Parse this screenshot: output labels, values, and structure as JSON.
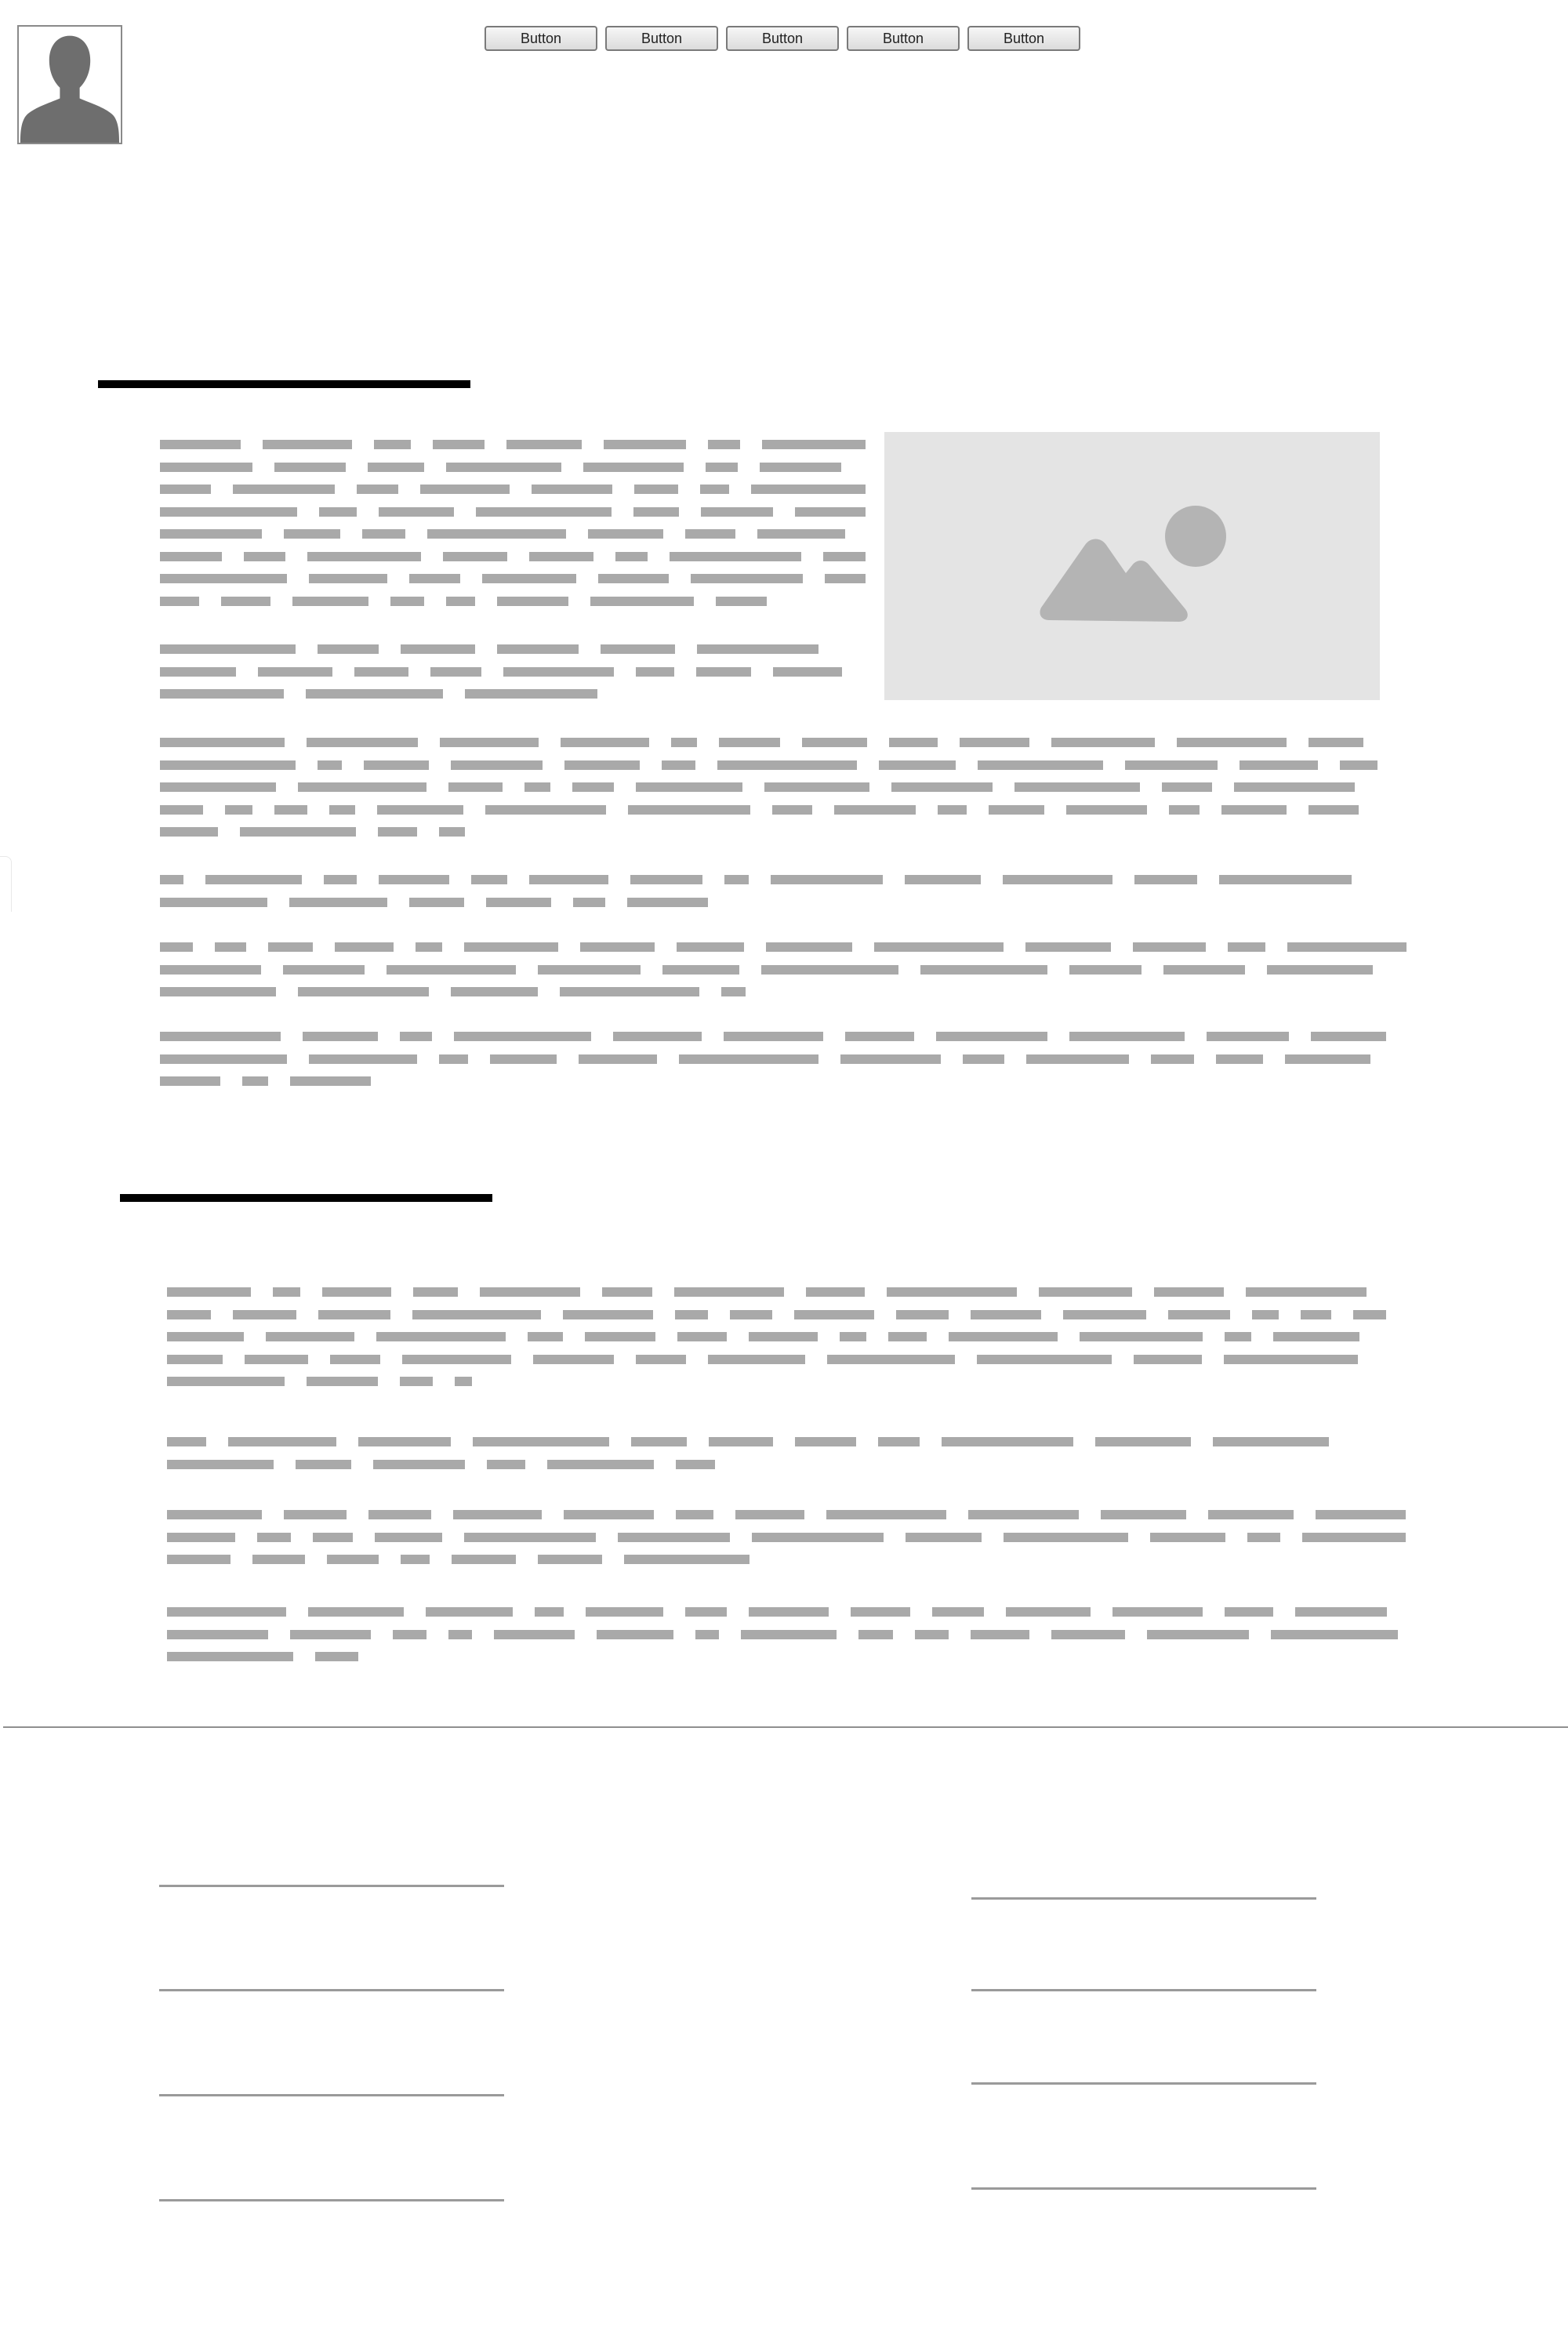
{
  "header": {
    "nav": [
      {
        "label": "Button"
      },
      {
        "label": "Button"
      },
      {
        "label": "Button"
      },
      {
        "label": "Button"
      },
      {
        "label": "Button"
      }
    ]
  },
  "colors": {
    "text_placeholder": "#a9a9a9",
    "image_placeholder_bg": "#e4e4e4",
    "image_placeholder_icon": "#b4b4b4",
    "heading_bar": "#000000",
    "divider": "#8f8f8f"
  },
  "icons": {
    "avatar": "user-silhouette-icon",
    "image": "image-placeholder-icon"
  },
  "sections": [
    {
      "heading": "",
      "paragraph_count": 6,
      "has_image": true
    },
    {
      "heading": "",
      "paragraph_count": 4,
      "has_image": false
    }
  ],
  "footer": {
    "left_links": [
      "",
      "",
      "",
      ""
    ],
    "right_links": [
      "",
      "",
      "",
      ""
    ]
  }
}
